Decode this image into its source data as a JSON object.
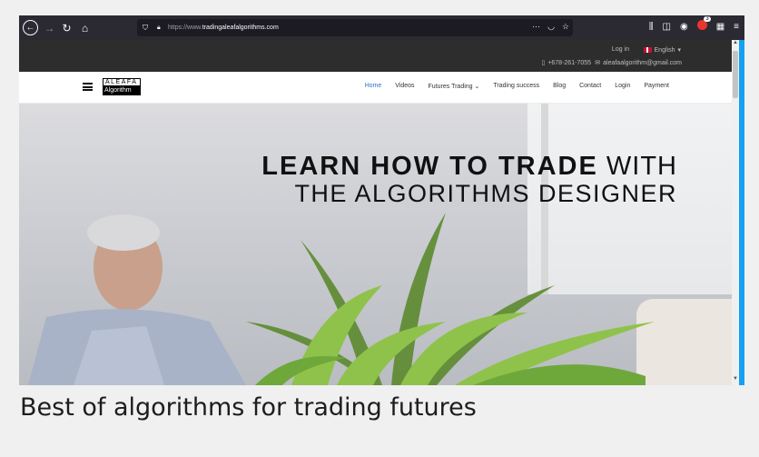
{
  "browser": {
    "url_scheme": "https://www.",
    "url_host": "tradingaleafalgorithms.com",
    "notification_count": "3",
    "icons": [
      "back-icon",
      "forward-icon",
      "reload-icon",
      "home-icon",
      "shield-icon",
      "lock-icon",
      "more-icon",
      "pocket-icon",
      "star-icon",
      "library-icon",
      "sidebar-icon",
      "account-icon",
      "extension-icon",
      "menu-icon"
    ]
  },
  "topbar": {
    "login": "Log in",
    "language": "English",
    "phone": "+678-261-7055",
    "email": "aleafaalgorithm@gmail.com"
  },
  "logo": {
    "top": "ALEAFA",
    "bottom": "Algorithm"
  },
  "menu": [
    {
      "label": "Home",
      "active": true
    },
    {
      "label": "Videos"
    },
    {
      "label": "Futures Trading ⌄"
    },
    {
      "label": "Trading success"
    },
    {
      "label": "Blog"
    },
    {
      "label": "Contact"
    },
    {
      "label": "Login"
    },
    {
      "label": "Payment"
    }
  ],
  "hero": {
    "line1_bold": "LEARN HOW TO TRADE",
    "line1_light": "WITH",
    "line2": "THE ALGORITHMS DESIGNER"
  },
  "caption": "Best of algorithms for trading futures",
  "colors": {
    "accent": "#2b74c9",
    "toolbar": "#2b2a33",
    "topbar": "#2d2d2d",
    "edge": "#16a1f0"
  }
}
